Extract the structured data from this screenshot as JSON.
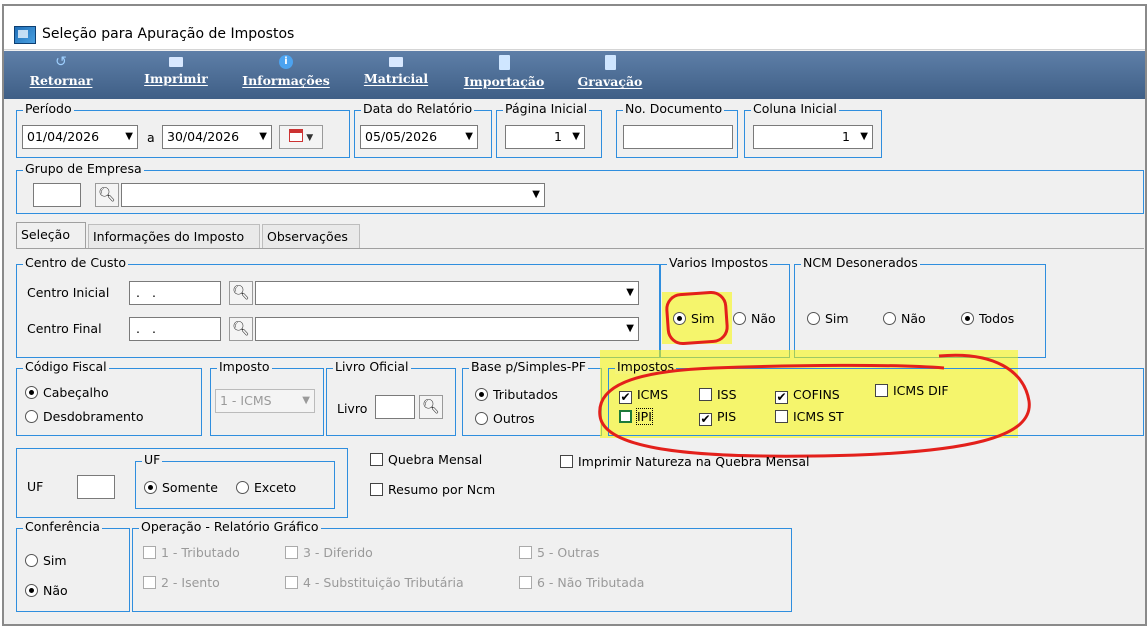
{
  "window": {
    "title": "Seleção para Apuração de Impostos"
  },
  "toolbar": {
    "buttons": [
      {
        "label": "Retornar",
        "icon": "return-arrow-icon"
      },
      {
        "label": "Imprimir",
        "icon": "printer-icon"
      },
      {
        "label": "Informações",
        "icon": "info-icon"
      },
      {
        "label": "Matricial",
        "icon": "dot-matrix-printer-icon"
      },
      {
        "label": "Importação",
        "icon": "import-document-icon"
      },
      {
        "label": "Gravação",
        "icon": "save-document-icon"
      }
    ]
  },
  "periodo": {
    "label": "Período",
    "start": "01/04/2026",
    "sep": "a",
    "end": "30/04/2026"
  },
  "data_relatorio": {
    "label": "Data do Relatório",
    "value": "05/05/2026"
  },
  "pagina_inicial": {
    "label": "Página Inicial",
    "value": "1"
  },
  "no_documento": {
    "label": "No. Documento",
    "value": ""
  },
  "coluna_inicial": {
    "label": "Coluna Inicial",
    "value": "1"
  },
  "grupo_empresa": {
    "label": "Grupo de Empresa",
    "code": "",
    "name": ""
  },
  "tabs": [
    {
      "label": "Seleção",
      "active": true
    },
    {
      "label": "Informações do Imposto",
      "active": false
    },
    {
      "label": "Observações",
      "active": false
    }
  ],
  "centro_custo": {
    "label": "Centro de Custo",
    "inicial_label": "Centro Inicial",
    "inicial_value": ". .",
    "final_label": "Centro Final",
    "final_value": ". ."
  },
  "varios_impostos": {
    "label": "Varios Impostos",
    "options": [
      "Sim",
      "Não"
    ],
    "selected": "Sim"
  },
  "ncm_desonerados": {
    "label": "NCM Desonerados",
    "options": [
      "Sim",
      "Não",
      "Todos"
    ],
    "selected": "Todos"
  },
  "codigo_fiscal": {
    "label": "Código Fiscal",
    "options": [
      "Cabeçalho",
      "Desdobramento"
    ],
    "selected": "Cabeçalho"
  },
  "imposto": {
    "label": "Imposto",
    "value": "1 - ICMS"
  },
  "livro_oficial": {
    "label": "Livro Oficial",
    "field_label": "Livro",
    "value": ""
  },
  "base_simples": {
    "label": "Base p/Simples-PF",
    "options": [
      "Tributados",
      "Outros"
    ],
    "selected": "Tributados"
  },
  "impostos": {
    "label": "Impostos",
    "items": [
      {
        "label": "ICMS",
        "checked": true
      },
      {
        "label": "ISS",
        "checked": false
      },
      {
        "label": "COFINS",
        "checked": true
      },
      {
        "label": "ICMS DIF",
        "checked": false
      },
      {
        "label": "IPI",
        "checked": false
      },
      {
        "label": "PIS",
        "checked": true
      },
      {
        "label": "ICMS ST",
        "checked": false
      }
    ]
  },
  "uf": {
    "label": "UF",
    "value": "",
    "group_label": "UF",
    "options": [
      "Somente",
      "Exceto"
    ],
    "selected": "Somente"
  },
  "quebra_mensal": {
    "label": "Quebra Mensal",
    "checked": false
  },
  "imprimir_natureza": {
    "label": "Imprimir Natureza na Quebra Mensal",
    "checked": false
  },
  "resumo_ncm": {
    "label": "Resumo por Ncm",
    "checked": false
  },
  "conferencia": {
    "label": "Conferência",
    "options": [
      "Sim",
      "Não"
    ],
    "selected": "Não"
  },
  "operacao": {
    "label": "Operação  - Relatório Gráfico",
    "items": [
      "1 - Tributado",
      "3 - Diferido",
      "5 - Outras",
      "2 - Isento",
      "4 - Substituição Tributária",
      "6 - Não Tributada"
    ]
  },
  "colors": {
    "toolbar": "#4a6a92",
    "groupbox_border": "#2f8ede",
    "highlight": "#f6f600",
    "annotation": "#e3201b"
  }
}
